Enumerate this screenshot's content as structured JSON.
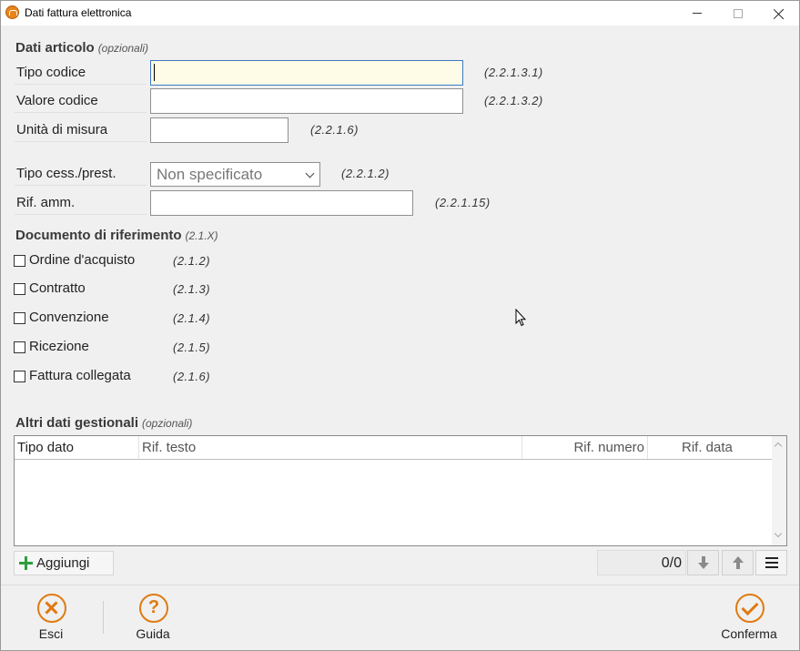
{
  "window": {
    "title": "Dati fattura elettronica",
    "accent_color": "#e07a10"
  },
  "dati_articolo": {
    "title": "Dati articolo",
    "optional": "(opzionali)",
    "tipo_codice": {
      "label": "Tipo codice",
      "value": "",
      "ref": "(2.2.1.3.1)"
    },
    "valore_codice": {
      "label": "Valore codice",
      "value": "",
      "ref": "(2.2.1.3.2)"
    },
    "unita_misura": {
      "label": "Unità di misura",
      "value": "",
      "ref": "(2.2.1.6)"
    },
    "tipo_cess": {
      "label": "Tipo cess./prest.",
      "selected": "Non specificato",
      "ref": "(2.2.1.2)"
    },
    "rif_amm": {
      "label": "Rif. amm.",
      "value": "",
      "ref": "(2.2.1.15)"
    }
  },
  "documento": {
    "title": "Documento di riferimento",
    "code": "(2.1.X)",
    "items": [
      {
        "label": "Ordine d'acquisto",
        "ref": "(2.1.2)",
        "checked": false
      },
      {
        "label": "Contratto",
        "ref": "(2.1.3)",
        "checked": false
      },
      {
        "label": "Convenzione",
        "ref": "(2.1.4)",
        "checked": false
      },
      {
        "label": "Ricezione",
        "ref": "(2.1.5)",
        "checked": false
      },
      {
        "label": "Fattura collegata",
        "ref": "(2.1.6)",
        "checked": false
      }
    ]
  },
  "altri_dati": {
    "title": "Altri dati gestionali",
    "optional": "(opzionali)",
    "columns": [
      "Tipo dato",
      "Rif. testo",
      "Rif. numero",
      "Rif. data"
    ],
    "rows": []
  },
  "toolbar": {
    "add_label": "Aggiungi",
    "counter": "0/0"
  },
  "footer": {
    "exit_label": "Esci",
    "help_label": "Guida",
    "help_glyph": "?",
    "confirm_label": "Conferma"
  }
}
